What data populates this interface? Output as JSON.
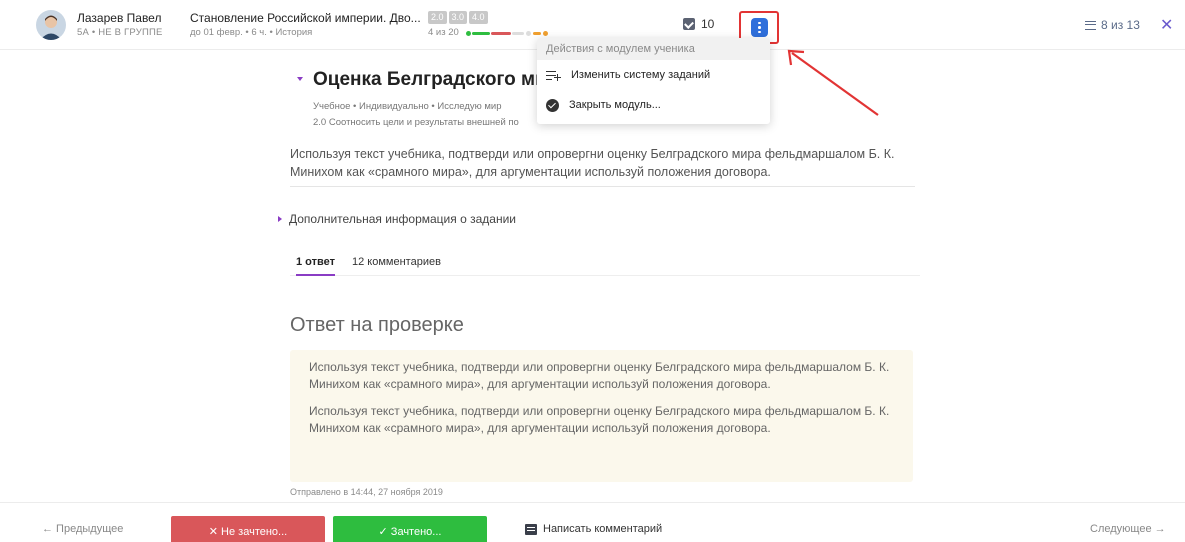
{
  "header": {
    "student_name": "Лазарев Павел",
    "student_meta": "5А • НЕ В ГРУППЕ",
    "module_title": "Становление Российской империи. Дво...",
    "module_meta": "до 01 февр. • 6 ч. • История",
    "levels": [
      "2.0",
      "3.0",
      "4.0"
    ],
    "progress_text": "4 из 20",
    "task_count": "10",
    "pager": "8 из 13",
    "close_symbol": "✕"
  },
  "menu": {
    "header": "Действия с модулем ученика",
    "items": [
      {
        "label": "Изменить систему заданий",
        "icon": "add-list-icon"
      },
      {
        "label": "Закрыть модуль...",
        "icon": "check-circle-icon"
      }
    ]
  },
  "task": {
    "title": "Оценка Белградского ми",
    "tags": "Учебное • Индивидуально • Исследую мир",
    "goal": "2.0 Соотносить цели и результаты внешней по",
    "text": "Используя текст учебника, подтверди или опровергни оценку Белградского мира фельдмаршалом Б. К. Минихом как «срамного мира», для аргументации используй положения договора.",
    "extra_info": "Дополнительная информация о задании"
  },
  "tabs": [
    "1 ответ",
    "12 комментариев"
  ],
  "answer": {
    "heading": "Ответ на проверке",
    "paragraphs": [
      "Используя текст учебника, подтверди или опровергни оценку Белградского мира фельдмаршалом Б. К. Минихом как «срамного мира», для аргументации используй положения договора.",
      "Используя текст учебника, подтверди или опровергни оценку Белградского мира фельдмаршалом Б. К. Минихом как «срамного мира», для аргументации используй положения договора."
    ],
    "sent": "Отправлено в 14:44, 27 ноября 2019"
  },
  "footer": {
    "prev": "← Предыдущее",
    "fail": "✕ Не зачтено...",
    "pass": "✓ Зачтено...",
    "comment": "Написать комментарий",
    "next": "Следующее →"
  },
  "colors": {
    "accent": "#8a3cc4",
    "menu_button": "#2f6fdb",
    "highlight": "#e23434",
    "fail": "#d9575a",
    "pass": "#2ebd3f",
    "answer_bg": "#fbf8ec"
  }
}
